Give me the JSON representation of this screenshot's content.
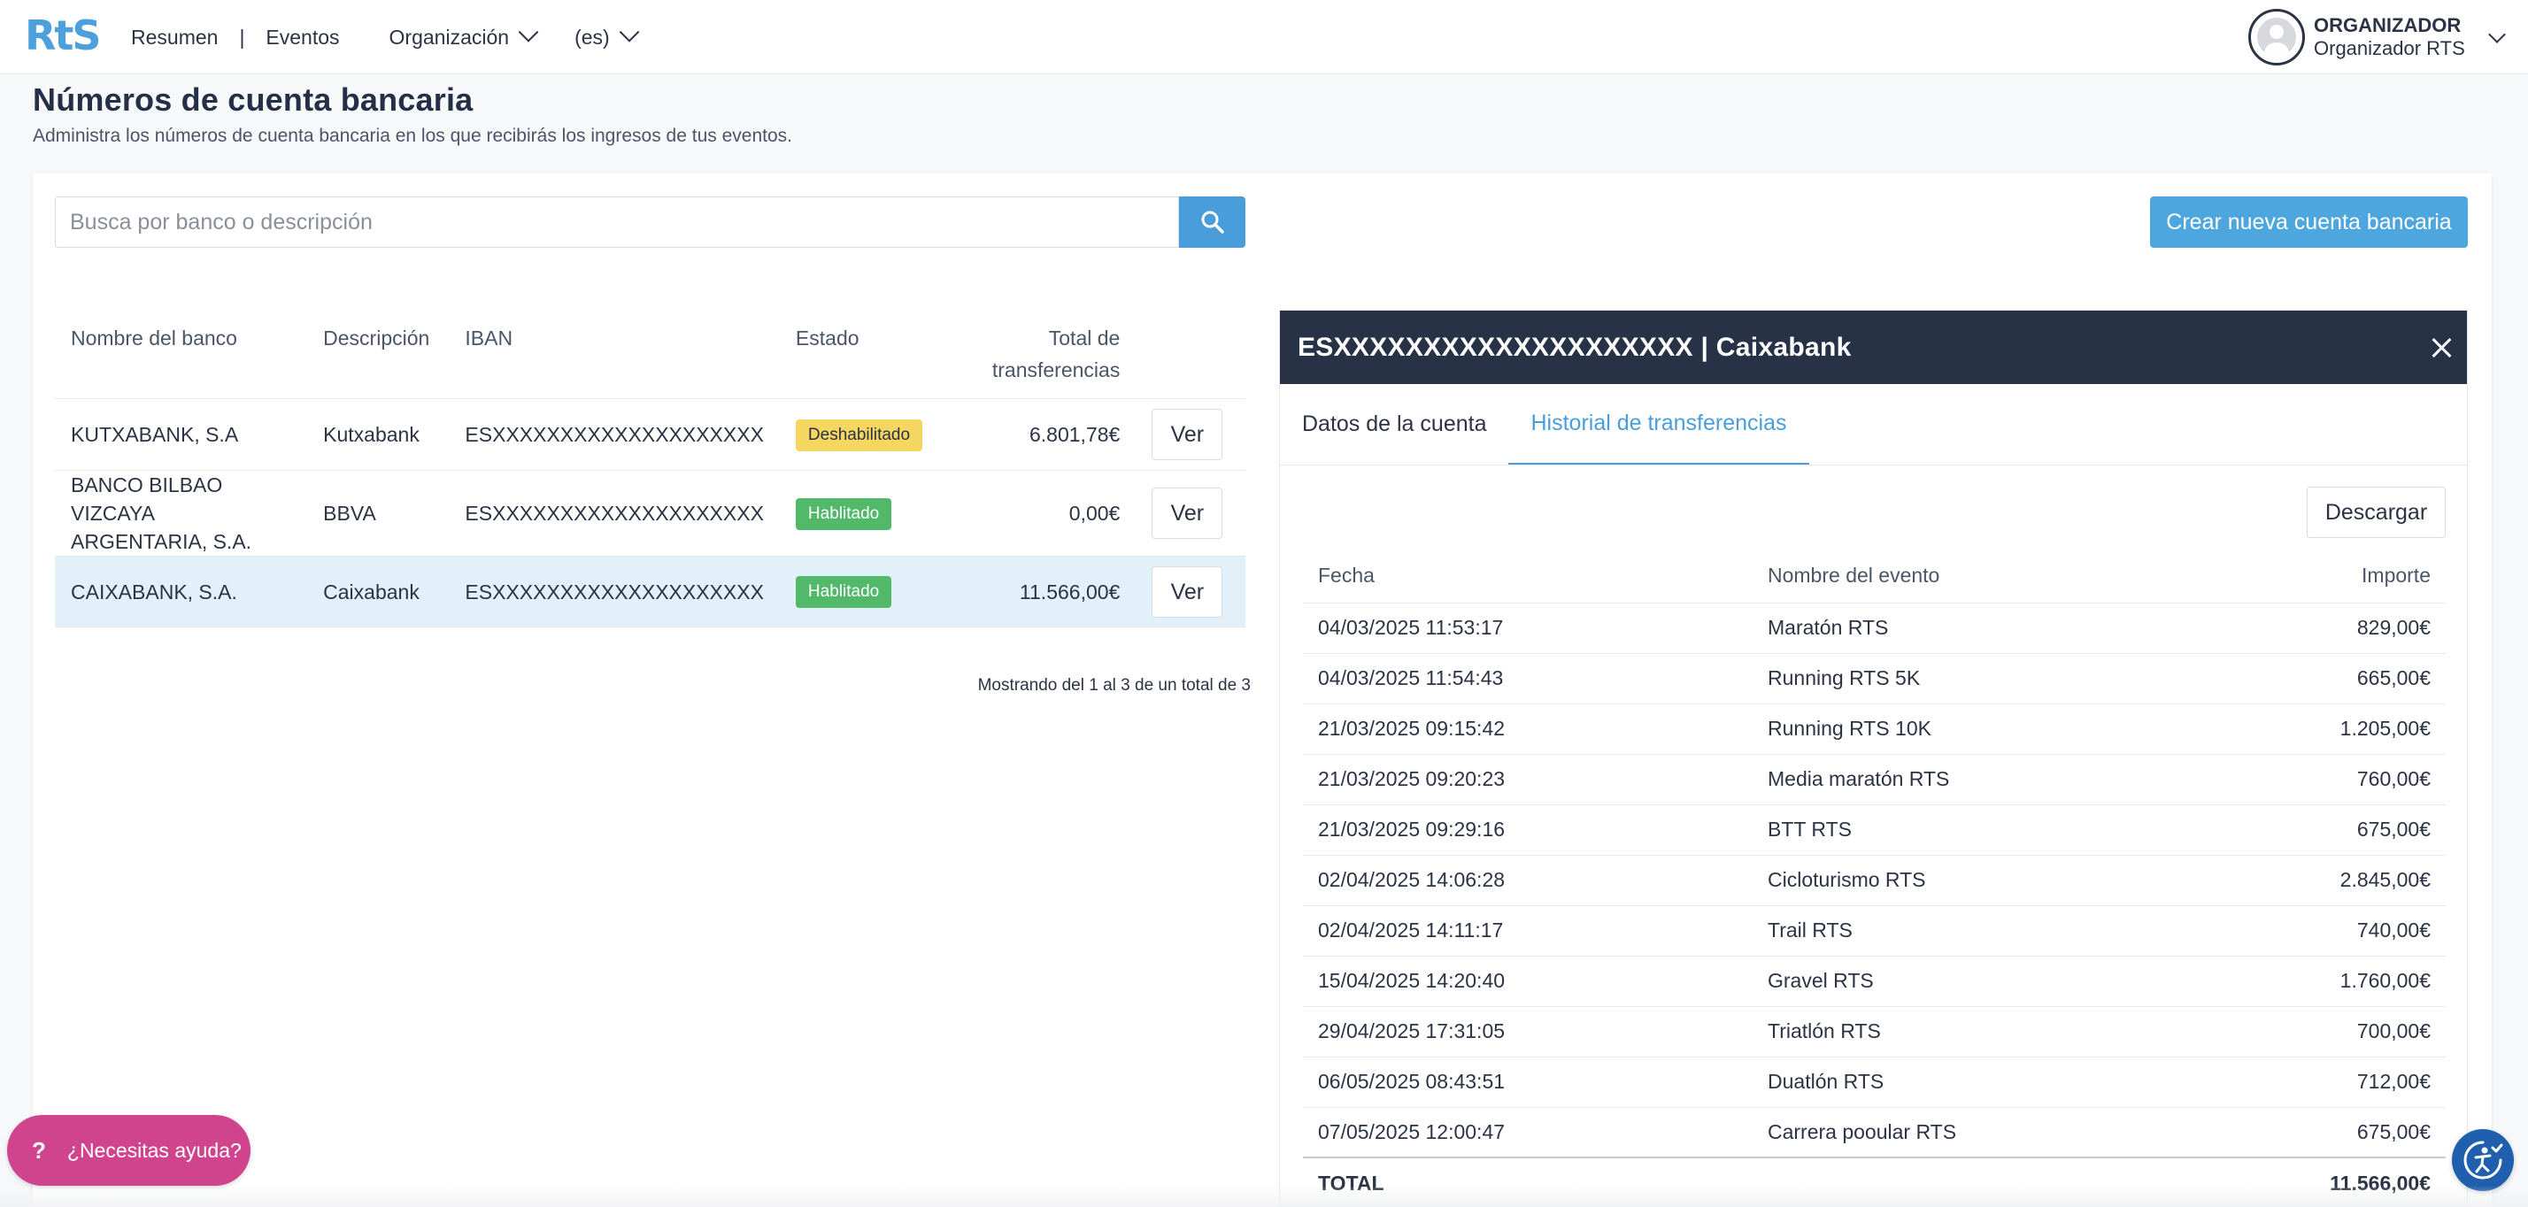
{
  "app": {
    "logo": "RtS"
  },
  "nav": {
    "resumen": "Resumen",
    "separator": "|",
    "eventos": "Eventos",
    "organizacion": "Organización",
    "language": "(es)"
  },
  "user": {
    "role": "ORGANIZADOR",
    "name": "Organizador RTS"
  },
  "page": {
    "title": "Números de cuenta bancaria",
    "subtitle": "Administra los números de cuenta bancaria en los que recibirás los ingresos de tus eventos."
  },
  "search": {
    "placeholder": "Busca por banco o descripción",
    "value": ""
  },
  "create_button": "Crear nueva cuenta bancaria",
  "accounts": {
    "headers": {
      "bank": "Nombre del banco",
      "description": "Descripción",
      "iban": "IBAN",
      "status": "Estado",
      "total": "Total de transferencias"
    },
    "rows": [
      {
        "bank": "KUTXABANK, S.A",
        "description": "Kutxabank",
        "iban": "ESXXXXXXXXXXXXXXXXXXXX",
        "status": "Deshabilitado",
        "total": "6.801,78€",
        "action": "Ver"
      },
      {
        "bank": "BANCO BILBAO VIZCAYA ARGENTARIA, S.A.",
        "description": "BBVA",
        "iban": "ESXXXXXXXXXXXXXXXXXXXX",
        "status": "Hablitado",
        "total": "0,00€",
        "action": "Ver"
      },
      {
        "bank": "CAIXABANK, S.A.",
        "description": "Caixabank",
        "iban": "ESXXXXXXXXXXXXXXXXXXXX",
        "status": "Hablitado",
        "total": "11.566,00€",
        "action": "Ver"
      }
    ],
    "pagination": "Mostrando del 1 al 3 de un total de 3"
  },
  "panel": {
    "title": "ESXXXXXXXXXXXXXXXXXXXX | Caixabank",
    "tabs": [
      "Datos de la cuenta",
      "Historial de transferencias"
    ],
    "active_tab": "Historial de transferencias",
    "download": "Descargar",
    "headers": {
      "date": "Fecha",
      "event": "Nombre del evento",
      "amount": "Importe"
    },
    "transfers": [
      {
        "date": "04/03/2025 11:53:17",
        "event": "Maratón RTS",
        "amount": "829,00€"
      },
      {
        "date": "04/03/2025 11:54:43",
        "event": "Running RTS 5K",
        "amount": "665,00€"
      },
      {
        "date": "21/03/2025 09:15:42",
        "event": "Running RTS 10K",
        "amount": "1.205,00€"
      },
      {
        "date": "21/03/2025 09:20:23",
        "event": "Media maratón RTS",
        "amount": "760,00€"
      },
      {
        "date": "21/03/2025 09:29:16",
        "event": "BTT RTS",
        "amount": "675,00€"
      },
      {
        "date": "02/04/2025 14:06:28",
        "event": "Cicloturismo RTS",
        "amount": "2.845,00€"
      },
      {
        "date": "02/04/2025 14:11:17",
        "event": "Trail RTS",
        "amount": "740,00€"
      },
      {
        "date": "15/04/2025 14:20:40",
        "event": "Gravel RTS",
        "amount": "1.760,00€"
      },
      {
        "date": "29/04/2025 17:31:05",
        "event": "Triatlón RTS",
        "amount": "700,00€"
      },
      {
        "date": "06/05/2025 08:43:51",
        "event": "Duatlón RTS",
        "amount": "712,00€"
      },
      {
        "date": "07/05/2025 12:00:47",
        "event": "Carrera pooular RTS",
        "amount": "675,00€"
      }
    ],
    "total_label": "TOTAL",
    "total_value": "11.566,00€"
  },
  "help": {
    "icon": "?",
    "label": "¿Necesitas ayuda?"
  },
  "colors": {
    "primary": "#4a9ddb",
    "panel_header": "#283247",
    "disabled_badge": "#f5d660",
    "enabled_badge": "#52b96a",
    "help_button": "#d0448e",
    "selected_row": "#e2f0fa"
  },
  "icons": {
    "search": "search-icon",
    "close": "close-icon",
    "avatar": "user-avatar-icon",
    "accessibility": "accessibility-icon"
  }
}
